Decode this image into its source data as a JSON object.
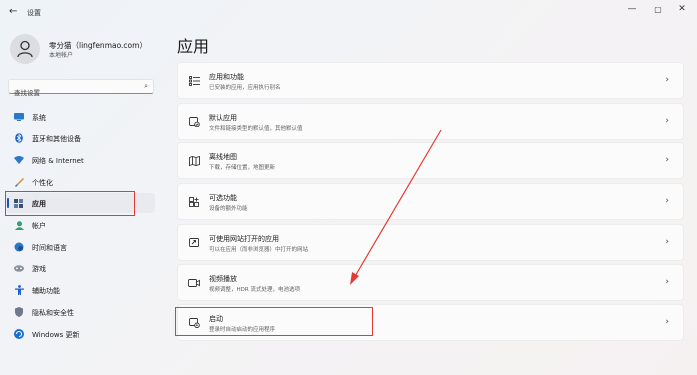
{
  "window": {
    "back_icon": "←",
    "title": "设置",
    "minimize_icon": "—",
    "maximize_icon": "▢",
    "close_icon": "✕"
  },
  "user": {
    "name": "零分猫（lingfenmao.com）",
    "account_type": "本地帐户"
  },
  "search": {
    "placeholder": "查找设置",
    "icon": "search-icon",
    "icon_glyph": "⌕"
  },
  "sidebar": {
    "items": [
      {
        "label": "系统",
        "icon": "monitor-icon",
        "color": "#2a78c8"
      },
      {
        "label": "蓝牙和其他设备",
        "icon": "bluetooth-icon",
        "color": "#1a5fcf"
      },
      {
        "label": "网络 & Internet",
        "icon": "wifi-icon",
        "color": "#2a78c8"
      },
      {
        "label": "个性化",
        "icon": "brush-icon",
        "color": "#d88a2a"
      },
      {
        "label": "应用",
        "icon": "apps-icon",
        "color": "#3c4e6a",
        "active": true
      },
      {
        "label": "帐户",
        "icon": "account-icon",
        "color": "#2ca36b"
      },
      {
        "label": "时间和语言",
        "icon": "globe-clock-icon",
        "color": "#2a78c8"
      },
      {
        "label": "游戏",
        "icon": "gamepad-icon",
        "color": "#7a7f8a"
      },
      {
        "label": "辅助功能",
        "icon": "accessibility-icon",
        "color": "#1a5fcf"
      },
      {
        "label": "隐私和安全性",
        "icon": "shield-icon",
        "color": "#6e7a8a"
      },
      {
        "label": "Windows 更新",
        "icon": "update-icon",
        "color": "#1a6fd0"
      }
    ]
  },
  "main": {
    "title": "应用",
    "chevron": "›",
    "cards": [
      {
        "title": "应用和功能",
        "desc": "已安装的应用，应用执行别名",
        "icon": "apps-list-icon"
      },
      {
        "title": "默认应用",
        "desc": "文件和链接类型的默认值，其他默认值",
        "icon": "default-apps-icon"
      },
      {
        "title": "离线地图",
        "desc": "下载，存储位置，地图更新",
        "icon": "offline-map-icon"
      },
      {
        "title": "可选功能",
        "desc": "设备的额外功能",
        "icon": "optional-features-icon"
      },
      {
        "title": "可使用网站打开的应用",
        "desc": "可以在应用（而非浏览器）中打开的网站",
        "icon": "website-apps-icon"
      },
      {
        "title": "视频播放",
        "desc": "视频调整，HDR 流式处理，电池选项",
        "icon": "video-playback-icon"
      },
      {
        "title": "启动",
        "desc": "登录时自动启动的应用程序",
        "icon": "startup-icon"
      }
    ]
  },
  "annotations": {
    "highlight_color": "#e53935"
  }
}
